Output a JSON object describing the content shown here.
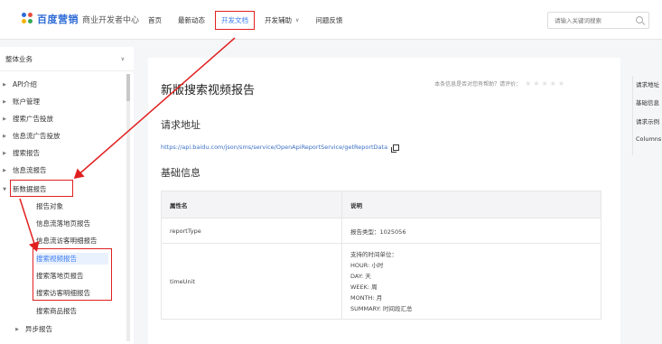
{
  "header": {
    "brand": "百度营销",
    "subtitle": "商业开发者中心",
    "nav": [
      {
        "label": "首页"
      },
      {
        "label": "最新动态"
      },
      {
        "label": "开发文档"
      },
      {
        "label": "开发辅助"
      },
      {
        "label": "问题反馈"
      }
    ],
    "search_placeholder": "请输入关键词搜索"
  },
  "sidebar": {
    "dropdown_label": "整体业务",
    "items": [
      {
        "label": "API介绍"
      },
      {
        "label": "账户管理"
      },
      {
        "label": "搜索广告投放"
      },
      {
        "label": "信息流广告投放"
      },
      {
        "label": "搜索报告"
      },
      {
        "label": "信息流报告"
      },
      {
        "label": "新数据报告"
      }
    ],
    "sub_items": [
      {
        "label": "报告对象"
      },
      {
        "label": "信息流落地页报告"
      },
      {
        "label": "信息流访客明细报告"
      },
      {
        "label": "搜索视频报告"
      },
      {
        "label": "搜索落地页报告"
      },
      {
        "label": "搜索访客明细报告"
      },
      {
        "label": "搜索商品报告"
      }
    ],
    "last_item": {
      "label": "异步报告"
    }
  },
  "main": {
    "title": "新版搜索视频报告",
    "helpful_text": "本条信息是否对您有帮助？请评价：",
    "stars": "★★★★★",
    "section_request": "请求地址",
    "url": "https://api.baidu.com/json/sms/service/OpenApiReportService/getReportData",
    "section_basic": "基础信息",
    "table": {
      "headers": [
        "属性名",
        "说明"
      ],
      "rows": [
        {
          "name": "reportType",
          "desc": [
            "报告类型：1025056"
          ]
        },
        {
          "name": "timeUnit",
          "desc": [
            "支持的时间单位：",
            "HOUR: 小时",
            "DAY: 天",
            "WEEK: 周",
            "MONTH: 月",
            "SUMMARY: 时间段汇总"
          ]
        }
      ]
    }
  },
  "toc": {
    "items": [
      {
        "label": "请求地址"
      },
      {
        "label": "基础信息"
      },
      {
        "label": "请求示例"
      },
      {
        "label": "Columns"
      }
    ]
  },
  "colors": {
    "accent": "#3b7cf2",
    "highlight": "#e02020"
  }
}
